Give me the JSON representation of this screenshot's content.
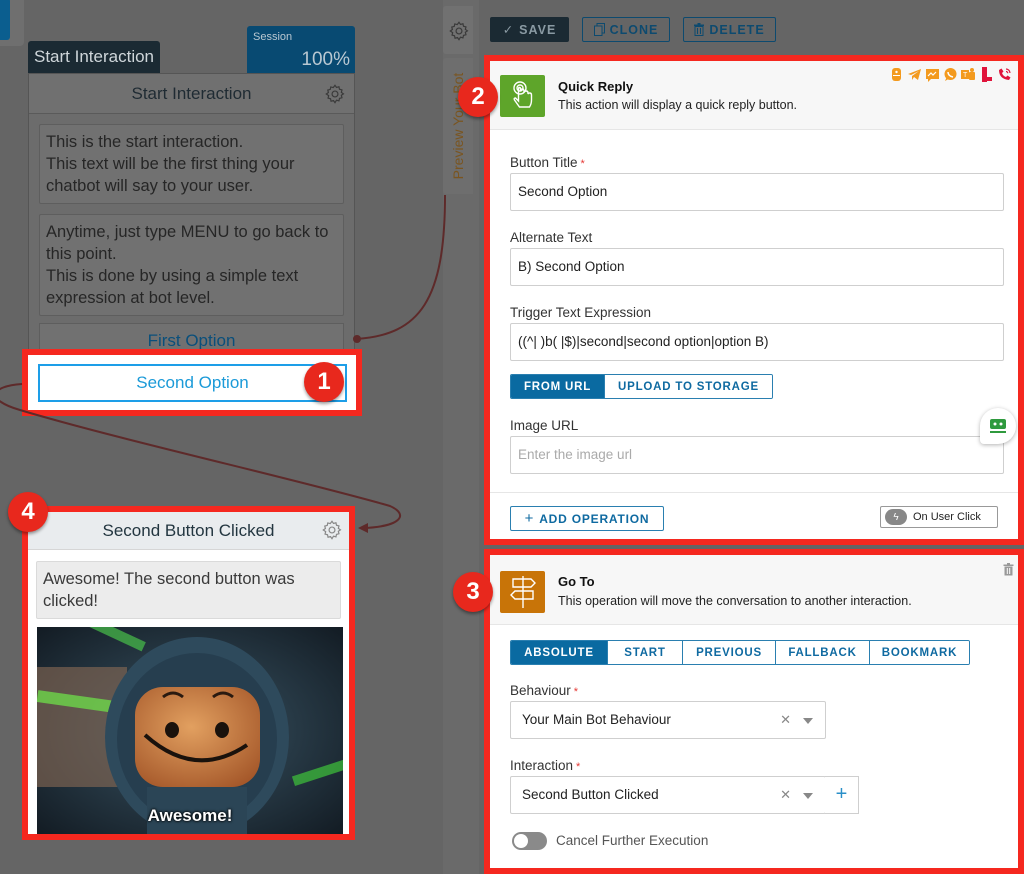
{
  "canvas": {
    "start_node": {
      "tag_label": "Start Interaction",
      "session_label": "Session",
      "session_value": "100%",
      "title": "Start Interaction",
      "messages": [
        "This is the start interaction.\nThis text will be the first thing your chatbot will say to your user.",
        "Anytime, just type MENU to go back to this point.\nThis is done by using a simple text expression at bot level."
      ],
      "options": [
        "First Option",
        "Second Option"
      ]
    },
    "target_node": {
      "title": "Second Button Clicked",
      "message": "Awesome! The second button was clicked!",
      "image_caption": "Awesome!"
    },
    "annotations": [
      "1",
      "2",
      "3",
      "4"
    ]
  },
  "side_tabs": {
    "preview_label": "Preview Your Bot"
  },
  "toolbar": {
    "save_label": "SAVE",
    "clone_label": "CLONE",
    "delete_label": "DELETE"
  },
  "quick_reply": {
    "title": "Quick Reply",
    "description": "This action will display a quick reply button.",
    "channel_icons": [
      "google-assistant",
      "telegram",
      "messenger",
      "whatsapp",
      "teams",
      "mobile-sms",
      "phone-call"
    ],
    "fields": {
      "button_title_label": "Button Title",
      "button_title_value": "Second Option",
      "alternate_text_label": "Alternate Text",
      "alternate_text_value": "B) Second Option",
      "trigger_label": "Trigger Text Expression",
      "trigger_value": "((^| )b( |$)|second|second option|option B)",
      "image_source_tabs": [
        "FROM URL",
        "UPLOAD TO STORAGE"
      ],
      "image_source_active": "FROM URL",
      "image_url_label": "Image URL",
      "image_url_placeholder": "Enter the image url",
      "image_url_value": ""
    },
    "add_operation_label": "ADD OPERATION",
    "trigger_button_label": "On User Click"
  },
  "goto": {
    "title": "Go To",
    "description": "This operation will move the conversation to another interaction.",
    "mode_tabs": [
      "ABSOLUTE",
      "START",
      "PREVIOUS",
      "FALLBACK",
      "BOOKMARK"
    ],
    "mode_active": "ABSOLUTE",
    "behaviour_label": "Behaviour",
    "behaviour_value": "Your Main Bot Behaviour",
    "interaction_label": "Interaction",
    "interaction_value": "Second Button Clicked",
    "cancel_label": "Cancel Further Execution",
    "cancel_enabled": false
  },
  "colors": {
    "highlight": "#f5281f",
    "accent_blue": "#0a6aa1",
    "quick_reply_icon": "#5ea52a",
    "goto_icon": "#c87408"
  }
}
